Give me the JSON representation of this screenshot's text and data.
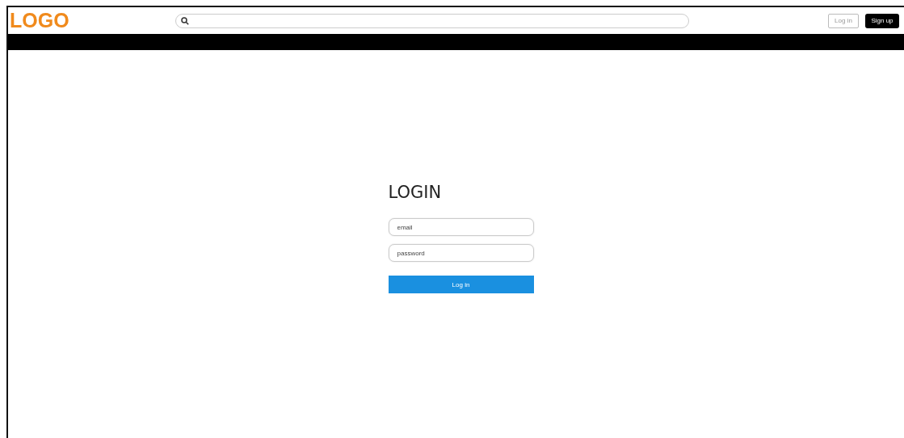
{
  "header": {
    "logo": "LOGO",
    "buttons": [
      {
        "label": "Log in",
        "kind": "outline"
      },
      {
        "label": "Sign up",
        "kind": "filled"
      }
    ]
  },
  "login": {
    "title": "LOGIN",
    "fields": [
      {
        "placeholder": "email"
      },
      {
        "placeholder": "password"
      }
    ],
    "submit": "Log in"
  }
}
